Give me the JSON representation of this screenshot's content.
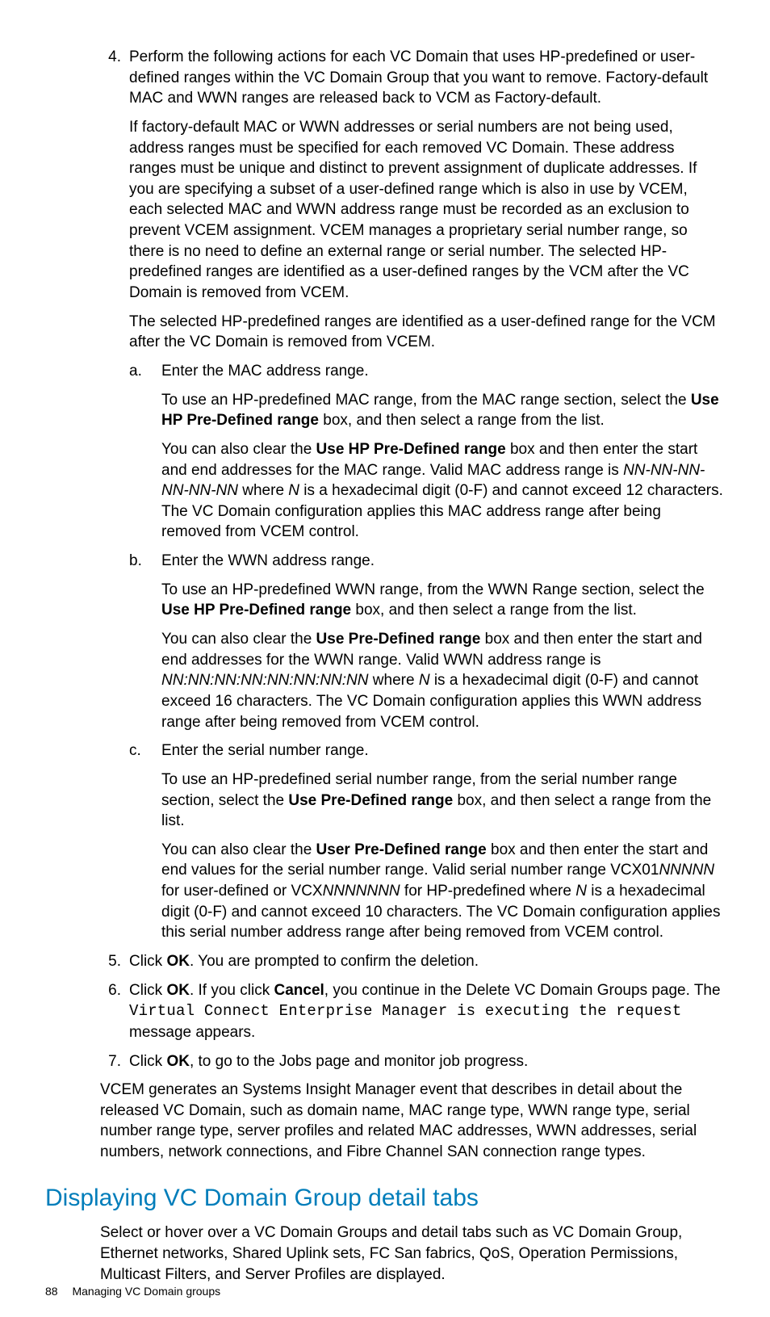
{
  "steps": {
    "s4": {
      "num": "4.",
      "p1": "Perform the following actions for each VC Domain that uses HP-predefined or user-defined ranges within the VC Domain Group that you want to remove. Factory-default MAC and WWN ranges are released back to VCM as Factory-default.",
      "p2": "If factory-default MAC or WWN addresses or serial numbers are not being used, address ranges must be specified for each removed VC Domain. These address ranges must be unique and distinct to prevent assignment of duplicate addresses. If you are specifying a subset of a user-defined range which is also in use by VCEM, each selected MAC and WWN address range must be recorded as an exclusion to prevent VCEM assignment. VCEM manages a proprietary serial number range, so there is no need to define an external range or serial number. The selected HP-predefined ranges are identified as a user-defined ranges by the VCM after the VC Domain is removed from VCEM.",
      "p3": "The selected HP-predefined ranges are identified as a user-defined range for the VCM after the VC Domain is removed from VCEM.",
      "a": {
        "lbl": "a.",
        "p1": "Enter the MAC address range.",
        "p2a": "To use an HP-predefined MAC range, from the MAC range section, select the ",
        "p2b": "Use HP Pre-Defined range",
        "p2c": " box, and then select a range from the list.",
        "p3a": "You can also clear the ",
        "p3b": "Use HP Pre-Defined range",
        "p3c": " box and then enter the start and end addresses for the MAC range. Valid MAC address range is ",
        "p3d": "NN-NN-NN-NN-NN-NN",
        "p3e": " where ",
        "p3f": "N",
        "p3g": " is a hexadecimal digit (0-F) and cannot exceed 12 characters. The VC Domain configuration applies this MAC address range after being removed from VCEM control."
      },
      "b": {
        "lbl": "b.",
        "p1": "Enter the WWN address range.",
        "p2a": "To use an HP-predefined WWN range, from the WWN Range section, select the ",
        "p2b": "Use HP Pre-Defined range",
        "p2c": " box, and then select a range from the list.",
        "p3a": "You can also clear the ",
        "p3b": "Use Pre-Defined range",
        "p3c": " box and then enter the start and end addresses for the WWN range. Valid WWN address range is ",
        "p3d": "NN:NN:NN:NN:NN:NN:NN:NN",
        "p3e": " where ",
        "p3f": "N",
        "p3g": " is a hexadecimal digit (0-F) and cannot exceed 16 characters. The VC Domain configuration applies this WWN address range after being removed from VCEM control."
      },
      "c": {
        "lbl": "c.",
        "p1": "Enter the serial number range.",
        "p2a": "To use an HP-predefined serial number range, from the serial number range section, select the ",
        "p2b": "Use Pre-Defined range",
        "p2c": " box, and then select a range from the list.",
        "p3a": "You can also clear the ",
        "p3b": "User Pre-Defined range",
        "p3c": " box and then enter the start and end values for the serial number range. Valid serial number range VCX01",
        "p3d": "NNNNN",
        "p3e": " for user-defined or VCX",
        "p3f": "NNNNNNN",
        "p3g": " for HP-predefined where ",
        "p3h": "N",
        "p3i": " is a hexadecimal digit (0-F) and cannot exceed 10 characters. The VC Domain configuration applies this serial number address range after being removed from VCEM control."
      }
    },
    "s5": {
      "num": "5.",
      "a": "Click ",
      "b": "OK",
      "c": ". You are prompted to confirm the deletion."
    },
    "s6": {
      "num": "6.",
      "a": "Click ",
      "b": "OK",
      "c": ". If you click ",
      "d": "Cancel",
      "e": ", you continue in the Delete VC Domain Groups page. The ",
      "f": "Virtual Connect Enterprise Manager is executing the request",
      "g": " message appears."
    },
    "s7": {
      "num": "7.",
      "a": "Click ",
      "b": "OK",
      "c": ", to go to the Jobs page and monitor job progress."
    }
  },
  "after": "VCEM generates an Systems Insight Manager event that describes in detail about the released VC Domain, such as domain name, MAC range type, WWN range type, serial number range type, server profiles and related MAC addresses, WWN addresses, serial numbers, network connections, and Fibre Channel SAN connection range types.",
  "heading": "Displaying VC Domain Group detail tabs",
  "heading_body": "Select or hover over a VC Domain Groups and detail tabs such as VC Domain Group, Ethernet networks, Shared Uplink sets, FC San fabrics, QoS, Operation Permissions, Multicast Filters, and Server Profiles are displayed.",
  "footer": {
    "page": "88",
    "title": "Managing VC Domain groups"
  }
}
